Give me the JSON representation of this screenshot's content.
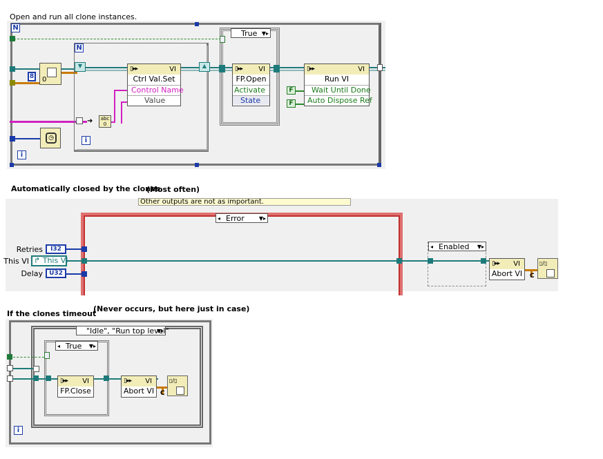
{
  "captions": {
    "top": "Open and run all clone instances.",
    "middle_main": "Automatically closed by the clones",
    "middle_note": "(Most often)",
    "bottom_main": "If the clones timeout",
    "bottom_note": "(Never occurs, but here just in case)",
    "note_box": "Other outputs are not as important."
  },
  "loops": {
    "outer_for": "N",
    "inner_for": "N",
    "iteration": "i",
    "const_8": "8",
    "const_0": "0"
  },
  "nodes": {
    "vi_label": "VI",
    "ctrl_val_set": {
      "name": "Ctrl Val.Set",
      "params": [
        "Control Name",
        "Value"
      ]
    },
    "fp_open": {
      "name": "FP.Open",
      "params": [
        "Activate",
        "State"
      ]
    },
    "run_vi": {
      "name": "Run VI",
      "params": [
        "Wait Until Done",
        "Auto Dispose Ref"
      ]
    },
    "abort_vi": {
      "name": "Abort VI"
    },
    "fp_close": {
      "name": "FP.Close"
    },
    "bool_false": "F"
  },
  "cases": {
    "true_case": "True",
    "error_case": "Error",
    "enabled_case": "Enabled",
    "idle_case": "\"Idle\", \"Run top level\"",
    "true_case_2": "True"
  },
  "middle_inputs": {
    "retries": {
      "label": "Retries",
      "type": "I32"
    },
    "this_vi": {
      "label": "This VI",
      "value": "This VI"
    },
    "delay": {
      "label": "Delay",
      "type": "U32"
    }
  },
  "colors": {
    "wire_teal": "#1e7a7a",
    "wire_pink": "#d020c0",
    "wire_orange": "#c87a00",
    "wire_blue": "#1a3aa8",
    "wire_green": "#2a8a2a",
    "frame_red": "#d04040",
    "frame_gray": "#777777"
  }
}
